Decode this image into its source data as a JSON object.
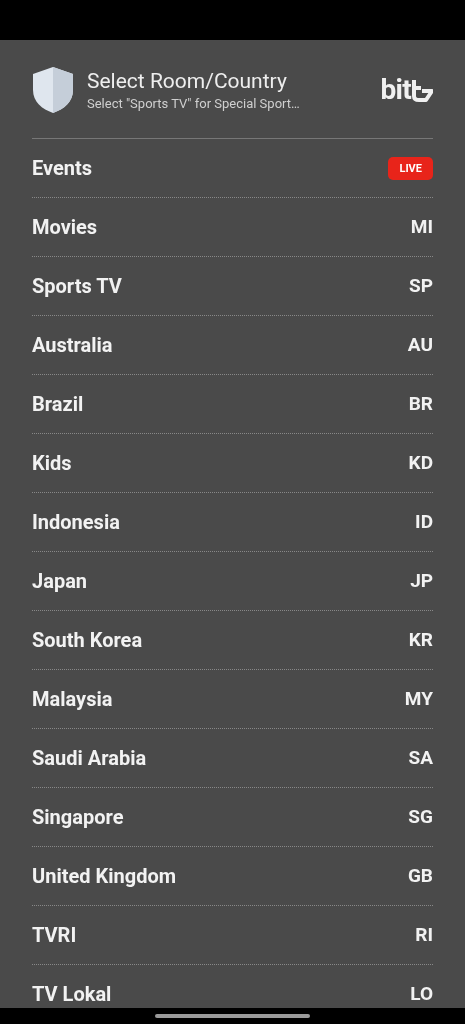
{
  "header": {
    "title": "Select Room/Country",
    "subtitle": "Select \"Sports TV\" for Special Sport…",
    "logo_text": "bit"
  },
  "rows": [
    {
      "kind": "badge",
      "label": "Events",
      "badge": "LIVE"
    },
    {
      "kind": "code",
      "label": "Movies",
      "code": "MI"
    },
    {
      "kind": "code",
      "label": "Sports TV",
      "code": "SP"
    },
    {
      "kind": "code",
      "label": "Australia",
      "code": "AU"
    },
    {
      "kind": "code",
      "label": "Brazil",
      "code": "BR"
    },
    {
      "kind": "code",
      "label": "Kids",
      "code": "KD"
    },
    {
      "kind": "code",
      "label": "Indonesia",
      "code": "ID"
    },
    {
      "kind": "code",
      "label": "Japan",
      "code": "JP"
    },
    {
      "kind": "code",
      "label": "South Korea",
      "code": "KR"
    },
    {
      "kind": "code",
      "label": "Malaysia",
      "code": "MY"
    },
    {
      "kind": "code",
      "label": "Saudi Arabia",
      "code": "SA"
    },
    {
      "kind": "code",
      "label": "Singapore",
      "code": "SG"
    },
    {
      "kind": "code",
      "label": "United Kingdom",
      "code": "GB"
    },
    {
      "kind": "code",
      "label": "TVRI",
      "code": "RI"
    },
    {
      "kind": "code",
      "label": "TV Lokal",
      "code": "LO"
    }
  ]
}
